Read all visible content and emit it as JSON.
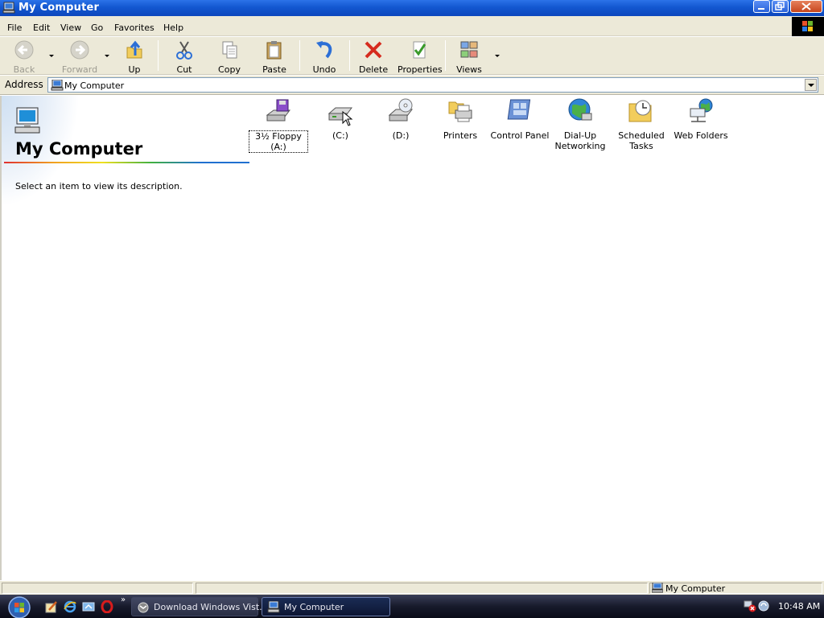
{
  "window": {
    "title": "My Computer"
  },
  "menu": [
    "File",
    "Edit",
    "View",
    "Go",
    "Favorites",
    "Help"
  ],
  "toolbar": {
    "back": "Back",
    "forward": "Forward",
    "up": "Up",
    "cut": "Cut",
    "copy": "Copy",
    "paste": "Paste",
    "undo": "Undo",
    "delete": "Delete",
    "properties": "Properties",
    "views": "Views"
  },
  "address": {
    "label": "Address",
    "value": "My Computer"
  },
  "left_pane": {
    "title": "My Computer",
    "description": "Select an item to view its description."
  },
  "items": [
    {
      "label_line1": "3½ Floppy",
      "label_line2": "(A:)"
    },
    {
      "label_line1": "(C:)",
      "label_line2": ""
    },
    {
      "label_line1": "(D:)",
      "label_line2": ""
    },
    {
      "label_line1": "Printers",
      "label_line2": ""
    },
    {
      "label_line1": "Control Panel",
      "label_line2": ""
    },
    {
      "label_line1": "Dial-Up",
      "label_line2": "Networking"
    },
    {
      "label_line1": "Scheduled",
      "label_line2": "Tasks"
    },
    {
      "label_line1": "Web Folders",
      "label_line2": ""
    }
  ],
  "status": {
    "text": "My Computer"
  },
  "taskbar": {
    "tasks": [
      "Download Windows Vist...",
      "My Computer"
    ],
    "clock": "10:48 AM"
  },
  "colors": {
    "title_blue": "#1357d0",
    "chrome": "#ece9d8",
    "taskbar": "#171a2b"
  }
}
